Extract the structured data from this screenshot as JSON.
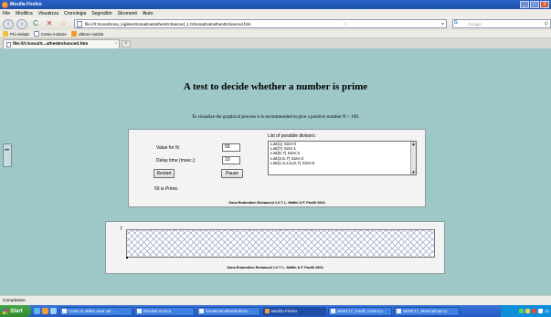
{
  "window": {
    "title": "Mozilla Firefox",
    "controls": [
      "_",
      "□",
      "X"
    ]
  },
  "menu": [
    "File",
    "Modifica",
    "Visualizza",
    "Cronologia",
    "Segnalibri",
    "Strumenti",
    "Aiuto"
  ],
  "nav": {
    "url": "file:///I:/sona/Sona_inglese/SonaEratosthenEnhanced_1.0/SonaEratosthenEnhanced.htm",
    "search_placeholder": "Google",
    "search_engine_icon": "G",
    "icons": {
      "back": "‹",
      "forward": "›",
      "reload": "C",
      "stop": "✕",
      "home": "⌂",
      "star": "☆",
      "dropdown": "▾",
      "search": "⚲"
    }
  },
  "bookmarks": [
    "Più visitati",
    "Come iniziare",
    "Ultime notizie"
  ],
  "tabs": [
    {
      "label": "file:///I:/sona/S...athenEnhanced.htm",
      "close": "×"
    }
  ],
  "new_tab": "+",
  "page": {
    "title": "A test to decide whether a number is prime",
    "subtitle": "To visualize the graphical process it is recommended to give a positive number N < 100.",
    "side_grip": "▸▸",
    "applet": {
      "value_label": "Value for N:",
      "value": "59",
      "delay_label": "Delay time (msec.):",
      "delay": "10",
      "restart_label": "Restart",
      "pause_label": "Pause",
      "result": "59 is Prime.",
      "divisors_label": "List of possible divisors:",
      "divisors": [
        "List(1) Size:0",
        "List(7) Size:1",
        "List(5,7) Size:2",
        "List(3,5,7) Size:3",
        "List(2,3,4,5,6,7) Size:6"
      ],
      "scroll_up": "▲",
      "scroll_down": "▼",
      "credit": "Sona Eratosthen Enhanced 1.0 © L. Maffei & F. Favilli 2004"
    },
    "grid_panel": {
      "row_number": "7",
      "credit": "Sona Eratosthen Enhanced 1.0 © L. Maffei & F. Favilli 2004"
    }
  },
  "status": "Completato",
  "taskbar": {
    "start": "Start",
    "tasks": [
      "Come si abilita Java nel ...",
      "Risultati ricerca",
      "SonaEratosthenEnhanc...",
      "Mozilla Firefox",
      "SEMT17_Favilli_Onal-Co...",
      "SEMT17_Materiali-per-p..."
    ],
    "active_task": 3,
    "clock": "12"
  }
}
